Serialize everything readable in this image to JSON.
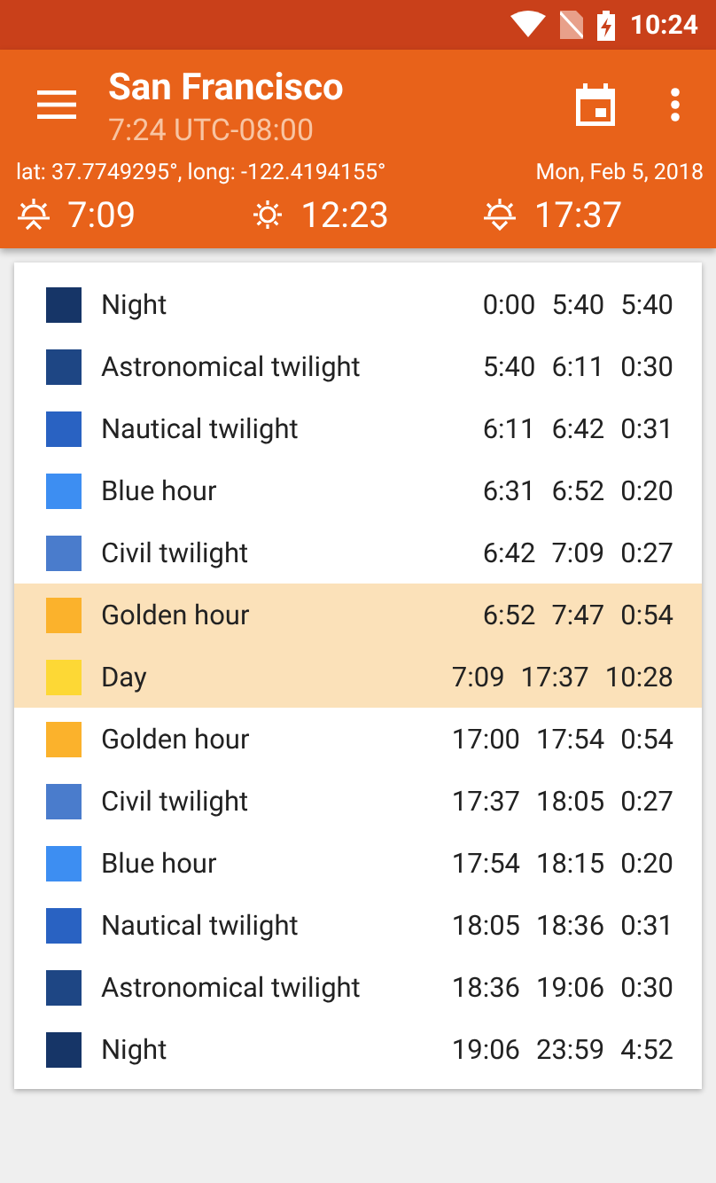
{
  "status_bar": {
    "time": "10:24"
  },
  "header": {
    "title": "San Francisco",
    "subtitle": "7:24 UTC-08:00",
    "coordinates": "lat: 37.7749295°, long: -122.4194155°",
    "date": "Mon, Feb 5, 2018"
  },
  "sun_times": [
    {
      "kind": "sunrise",
      "time": "7:09"
    },
    {
      "kind": "noon",
      "time": "12:23"
    },
    {
      "kind": "sunset",
      "time": "17:37"
    }
  ],
  "periods": [
    {
      "name": "Night",
      "color": "#163567",
      "start": "0:00",
      "end": "5:40",
      "duration": "5:40",
      "highlighted": false
    },
    {
      "name": "Astronomical twilight",
      "color": "#1e4684",
      "start": "5:40",
      "end": "6:11",
      "duration": "0:30",
      "highlighted": false
    },
    {
      "name": "Nautical twilight",
      "color": "#2962c2",
      "start": "6:11",
      "end": "6:42",
      "duration": "0:31",
      "highlighted": false
    },
    {
      "name": "Blue hour",
      "color": "#3d8ef2",
      "start": "6:31",
      "end": "6:52",
      "duration": "0:20",
      "highlighted": false
    },
    {
      "name": "Civil twilight",
      "color": "#4a7ccc",
      "start": "6:42",
      "end": "7:09",
      "duration": "0:27",
      "highlighted": false
    },
    {
      "name": "Golden hour",
      "color": "#fbb22c",
      "start": "6:52",
      "end": "7:47",
      "duration": "0:54",
      "highlighted": true
    },
    {
      "name": "Day",
      "color": "#fdd835",
      "start": "7:09",
      "end": "17:37",
      "duration": "10:28",
      "highlighted": true
    },
    {
      "name": "Golden hour",
      "color": "#fbb22c",
      "start": "17:00",
      "end": "17:54",
      "duration": "0:54",
      "highlighted": false
    },
    {
      "name": "Civil twilight",
      "color": "#4a7ccc",
      "start": "17:37",
      "end": "18:05",
      "duration": "0:27",
      "highlighted": false
    },
    {
      "name": "Blue hour",
      "color": "#3d8ef2",
      "start": "17:54",
      "end": "18:15",
      "duration": "0:20",
      "highlighted": false
    },
    {
      "name": "Nautical twilight",
      "color": "#2962c2",
      "start": "18:05",
      "end": "18:36",
      "duration": "0:31",
      "highlighted": false
    },
    {
      "name": "Astronomical twilight",
      "color": "#1e4684",
      "start": "18:36",
      "end": "19:06",
      "duration": "0:30",
      "highlighted": false
    },
    {
      "name": "Night",
      "color": "#163567",
      "start": "19:06",
      "end": "23:59",
      "duration": "4:52",
      "highlighted": false
    }
  ]
}
